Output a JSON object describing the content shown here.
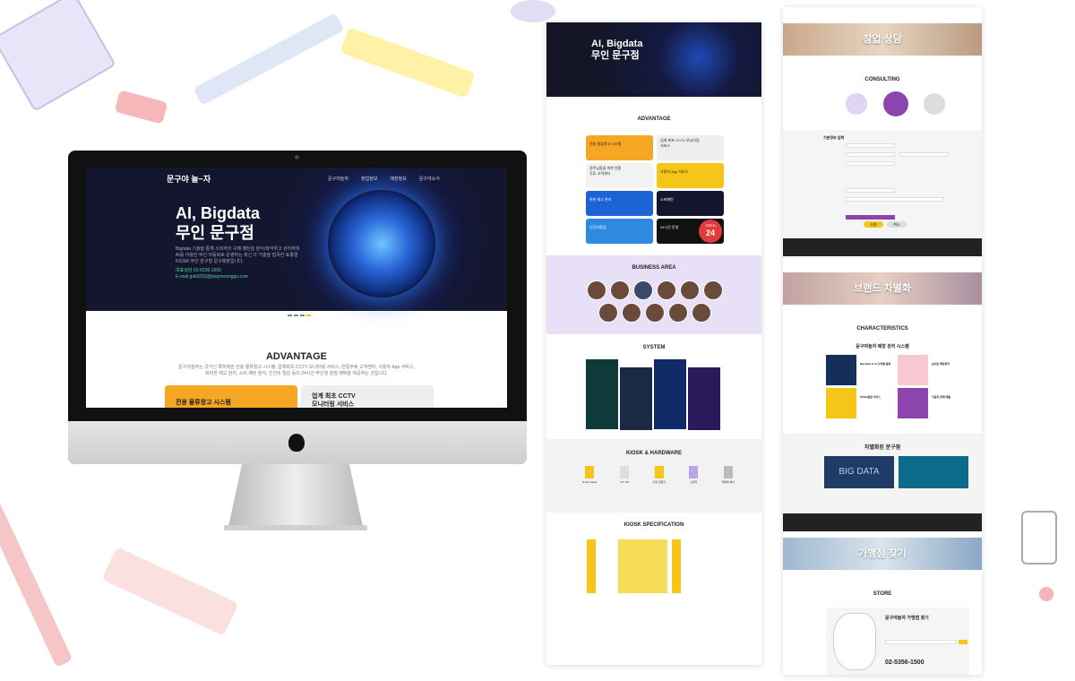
{
  "monitor": {
    "logo": "문구야 놀~자",
    "nav": [
      "문구야놀자",
      "창업정보",
      "매장정보",
      "문구야소식"
    ],
    "hero_title_line1": "AI, Bigdata",
    "hero_title_line2": "무인 문구점",
    "hero_desc_1": "Bigdata 기술을 통해 소비자의 구매 패턴을 분석/파악하고 관리하며",
    "hero_desc_2": "AI를 이용한 무인 자동화로 운영하는 최신 IT 기술을 접목한 토종형",
    "hero_desc_3": "KIOSK 무인 완구형 문구매장입니다.",
    "phone": "대표상담 02-6336-1500",
    "email": "E-mail  gob0202@playmoonggu.com",
    "advantage_title": "ADVANTAGE",
    "advantage_desc_1": "문구야놀자는 국가신 특허제한 전용 물류창고 시스템, 업계최초 CCTV 모니터링 서비스, 연중무휴 고객센터, 사용자 App 서비스,",
    "advantage_desc_2": "화려한 재고 관리, 소비 패턴 분석, 인건비 절감 등의 24시간 무인점 장점 혜택을 제공하는 것입니다.",
    "card1": "전용 물류창고 시스템",
    "card2_1": "업계 최초 CCTV",
    "card2_2": "모니터링 서비스"
  },
  "panel1": {
    "hero_title_line1": "AI, Bigdata",
    "hero_title_line2": "무인 문구점",
    "advantage": "ADVANTAGE",
    "tiles": [
      "전용 물류창고 시스템",
      "업계 최초 CCTV 모니터링 서비스",
      "점주님들을 위한 연중 무휴 고객센터",
      "사용자 App 서비스",
      "완판 재고 관리",
      "소비패턴",
      "인건비절감",
      "24시간 운영"
    ],
    "business_area": "BUSINESS AREA",
    "system": "SYSTEM",
    "kiosk_hw": "KIOSK & HARDWARE",
    "kiosk_items": [
      "Smart Kiosk",
      "IoT Ctrl",
      "출입 인증기",
      "스피커",
      "카메라/센서"
    ],
    "kiosk_spec": "KIOSK SPECIFICATION",
    "badge_open": "OPEN",
    "badge_24": "24"
  },
  "panel2": {
    "banner1": "창업 상담",
    "consulting": "CONSULTING",
    "form_title": "기본정보 입력",
    "btn_submit": "신청",
    "btn_cancel": "취소",
    "banner2": "브랜드 차별화",
    "characteristics": "CHARACTERISTICS",
    "char_sub": "문구야놀자 매장 관리 시스템",
    "feature1": "Big Data & AI 소비를 활용",
    "feature2": "손쉬운 매장관리",
    "feature3": "PUSH알림 서비스",
    "feature4": "다품목 판매 매출",
    "diff_title": "차별화된 문구점",
    "bigdata": "BIG DATA",
    "banner3": "가맹점 찾기",
    "store": "STORE",
    "store_find": "문구야놀자 가맹점 찾기",
    "phone": "02-5356-1500"
  },
  "colors": {
    "accent": "#f5c518",
    "purple": "#8e44ad",
    "dark": "#14162f"
  }
}
